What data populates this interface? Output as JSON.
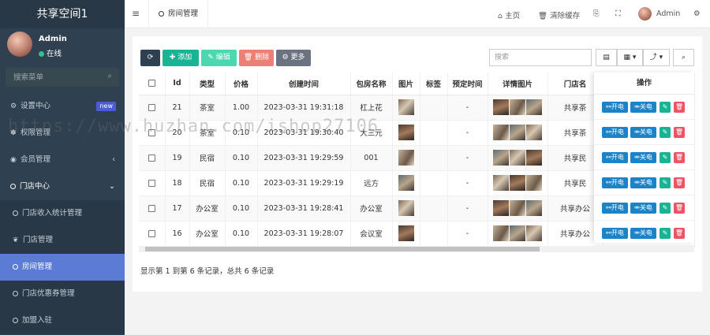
{
  "app": {
    "title": "共享空间1"
  },
  "user": {
    "name": "Admin",
    "status": "在线"
  },
  "sidebar": {
    "search_placeholder": "搜索菜单",
    "items": [
      {
        "icon": "gears-icon",
        "label": "设置中心",
        "badge": "new"
      },
      {
        "icon": "paw-icon",
        "label": "权限管理"
      },
      {
        "icon": "user-circle-icon",
        "label": "会员管理",
        "arrow": "‹"
      },
      {
        "icon": "circle-icon",
        "label": "门店中心",
        "arrow": "⌄"
      },
      {
        "icon": "circle-icon",
        "label": "门店收入统计管理"
      },
      {
        "icon": "leaf-icon",
        "label": "门店管理"
      },
      {
        "icon": "circle-icon",
        "label": "房间管理",
        "active": true
      },
      {
        "icon": "circle-icon",
        "label": "门店优惠券管理"
      },
      {
        "icon": "circle-icon",
        "label": "加盟入驻"
      }
    ]
  },
  "topbar": {
    "tab": "房间管理",
    "home": "主页",
    "clear_cache": "清除缓存",
    "user": "Admin"
  },
  "toolbar": {
    "add": "添加",
    "edit": "编辑",
    "delete": "删除",
    "more": "更多",
    "search_placeholder": "搜索"
  },
  "table": {
    "headers": [
      "Id",
      "类型",
      "价格",
      "创建时间",
      "包房名称",
      "图片",
      "标签",
      "预定时间",
      "详情图片",
      "门店名",
      "操作"
    ],
    "rows": [
      {
        "id": "21",
        "type": "茶室",
        "price": "1.00",
        "time": "2023-03-31 19:31:18",
        "name": "杠上花",
        "date": "-",
        "store": "共享茶"
      },
      {
        "id": "20",
        "type": "茶室",
        "price": "0.10",
        "time": "2023-03-31 19:30:40",
        "name": "大三元",
        "date": "-",
        "store": "共享茶"
      },
      {
        "id": "19",
        "type": "民宿",
        "price": "0.10",
        "time": "2023-03-31 19:29:59",
        "name": "001",
        "date": "-",
        "store": "共享民"
      },
      {
        "id": "18",
        "type": "民宿",
        "price": "0.10",
        "time": "2023-03-31 19:29:19",
        "name": "远方",
        "date": "-",
        "store": "共享民"
      },
      {
        "id": "17",
        "type": "办公室",
        "price": "0.10",
        "time": "2023-03-31 19:28:41",
        "name": "办公室",
        "date": "-",
        "store": "共享办公"
      },
      {
        "id": "16",
        "type": "办公室",
        "price": "0.10",
        "time": "2023-03-31 19:28:07",
        "name": "会议室",
        "date": "-",
        "store": "共享办公"
      }
    ],
    "op_on": "开电",
    "op_off": "关电"
  },
  "footer": {
    "summary": "显示第 1 到第 6 条记录，总共 6 条记录"
  },
  "watermark": "https://www.huzhan.com/ishop27106",
  "colors": {
    "sidebar": "#2f4050",
    "active": "#5b7bd5",
    "add": "#1ab394",
    "edit": "#4cd7b0",
    "delete": "#ed8075",
    "more": "#6b7280",
    "refresh": "#2f4050",
    "op_blue": "#1c84c6",
    "op_green": "#1ab394",
    "op_red": "#ed5565"
  }
}
